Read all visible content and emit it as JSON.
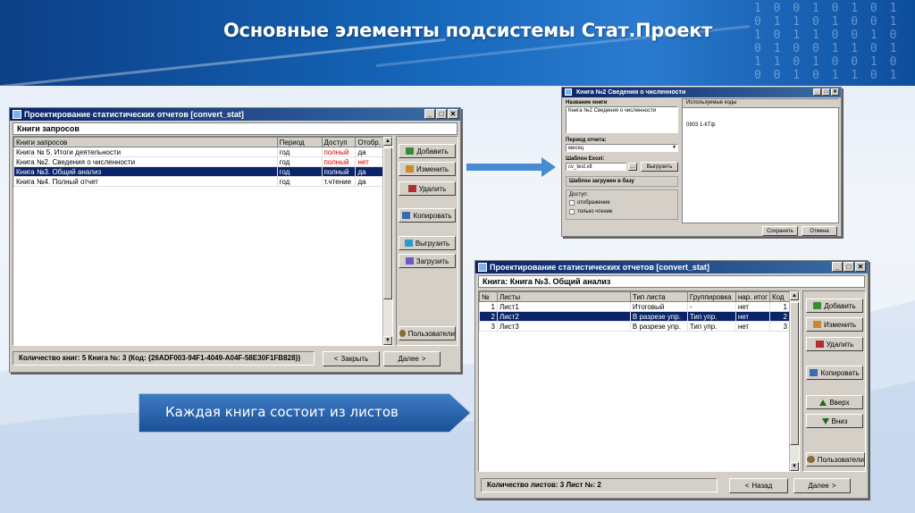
{
  "slide": {
    "title": "Основные элементы подсистемы Стат.Проект",
    "callout": "Каждая книга состоит  из листов"
  },
  "window1": {
    "title": "Проектирование статистических отчетов  [convert_stat]",
    "heading": "Книги запросов",
    "columns": [
      "Книги запросов",
      "Период",
      "Доступ",
      "Отобр."
    ],
    "rows": [
      {
        "name": "Книга № 5. Итоги деятельности",
        "period": "год",
        "access": "полный",
        "show": "да",
        "access_red": true,
        "show_red": false
      },
      {
        "name": "Книга №2. Сведения о численности",
        "period": "год",
        "access": "полный",
        "show": "нет",
        "access_red": true,
        "show_red": true
      },
      {
        "name": "Книга №3. Общий анализ",
        "period": "год",
        "access": "полный",
        "show": "да",
        "access_red": true,
        "show_red": false,
        "selected": true
      },
      {
        "name": "Книга №4. Полный отчет",
        "period": "год",
        "access": "т.чтение",
        "show": "да",
        "access_red": false,
        "show_red": false
      }
    ],
    "buttons": {
      "add": "Добавить",
      "edit": "Изменить",
      "delete": "Удалить",
      "copy": "Копировать",
      "export": "Выгрузить",
      "import": "Загрузить",
      "users": "Пользователи"
    },
    "status": "Количество книг: 5    Книга №: 3 (Код: {26ADF003-94F1-4049-A04F-58E30F1FB828})",
    "close_label": "Закрыть",
    "next_label": "Далее"
  },
  "window2": {
    "title": "Книга №2 Сведения о численности",
    "name_label": "Название книги",
    "name_value": "Книга №2 Сведения о численности",
    "period_label": "Период отчета:",
    "period_value": "месяц",
    "excel_label": "Шаблон Excel:",
    "excel_value": "cv_test.xlt",
    "export_label": "Выгрузить",
    "load_label": "Шаблон загружен в базу",
    "access_label": "Доступ:",
    "opt1": "отображение",
    "opt2": "только чтение",
    "tab_label": "Используемые коды",
    "codes_value": "0903 1-КТф",
    "save_label": "Сохранить",
    "cancel_label": "Отмена"
  },
  "window3": {
    "title": "Проектирование статистических отчетов  [convert_stat]",
    "heading": "Книга: Книга №3. Общий анализ",
    "columns": [
      "№",
      "Листы",
      "Тип листа",
      "Группировка",
      "нар. итог",
      "Код"
    ],
    "rows": [
      {
        "num": "1",
        "name": "Лист1",
        "type": "Итоговый",
        "group": "-",
        "total": "нет",
        "code": "1"
      },
      {
        "num": "2",
        "name": "Лист2",
        "type": "В разрезе упр.",
        "group": "Тип упр.",
        "total": "нет",
        "code": "2",
        "selected": true
      },
      {
        "num": "3",
        "name": "Лист3",
        "type": "В разрезе упр.",
        "group": "Тип упр.",
        "total": "нет",
        "code": "3"
      }
    ],
    "buttons": {
      "add": "Добавить",
      "edit": "Изменить",
      "delete": "Удалить",
      "copy": "Копировать",
      "up": "Вверх",
      "down": "Вниз",
      "users": "Пользователи"
    },
    "status": "Количество листов: 3    Лист №: 2",
    "back_label": "Назад",
    "next_label": "Далее"
  },
  "colors": {
    "banner": "#1565b8",
    "selection": "#0a246a",
    "window_face": "#d4d0c8",
    "callout": "#1e5ea8"
  }
}
